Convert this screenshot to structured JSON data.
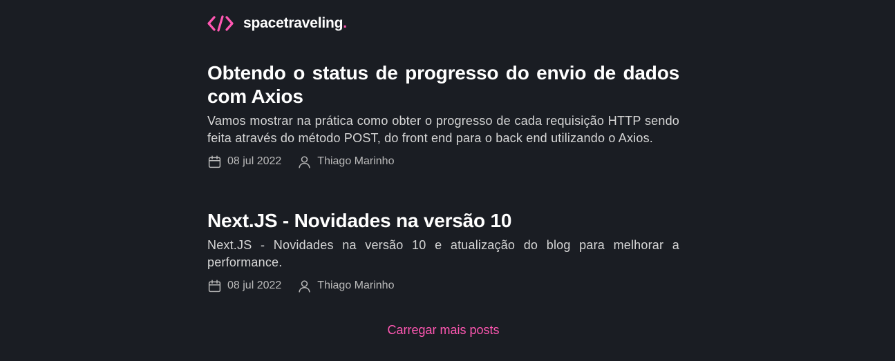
{
  "header": {
    "logo_icon": "code-brackets-icon",
    "logo_text": "spacetraveling",
    "logo_dot": ".",
    "accent_color": "#ff57b2"
  },
  "posts": [
    {
      "title": "Obtendo o status de progresso do envio de dados com Axios",
      "subtitle": "Vamos mostrar na prática como obter o progresso de cada requisição HTTP sendo feita através do método POST, do front end para o back end utilizando o Axios.",
      "date": "08 jul 2022",
      "author": "Thiago Marinho",
      "date_icon": "calendar-icon",
      "author_icon": "user-icon"
    },
    {
      "title": "Next.JS - Novidades na versão 10",
      "subtitle": "Next.JS - Novidades na versão 10 e atualização do blog para melhorar a performance.",
      "date": "08 jul 2022",
      "author": "Thiago Marinho",
      "date_icon": "calendar-icon",
      "author_icon": "user-icon"
    }
  ],
  "load_more_label": "Carregar mais posts",
  "colors": {
    "background": "#1a1d23",
    "heading": "#ffffff",
    "body_text": "#d7d7d7",
    "meta_text": "#bbbbbb",
    "accent": "#ff57b2"
  }
}
